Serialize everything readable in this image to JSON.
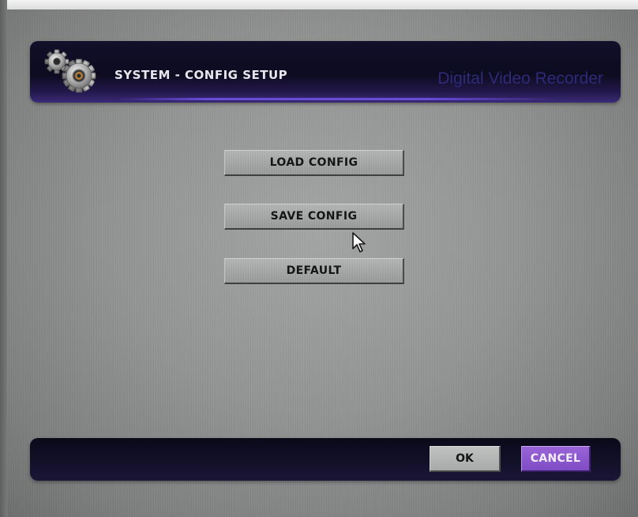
{
  "header": {
    "title": "SYSTEM - CONFIG SETUP",
    "brand": "Digital Video Recorder",
    "icon": "gears-icon"
  },
  "menu": {
    "items": [
      {
        "label": "LOAD CONFIG"
      },
      {
        "label": "SAVE CONFIG"
      },
      {
        "label": "DEFAULT"
      }
    ]
  },
  "footer": {
    "ok_label": "OK",
    "cancel_label": "CANCEL"
  },
  "colors": {
    "header_bg": "#0d0b20",
    "brand_text": "#2e2a78",
    "cancel_accent": "#8a56cc",
    "button_gray": "#a3a5a4"
  }
}
